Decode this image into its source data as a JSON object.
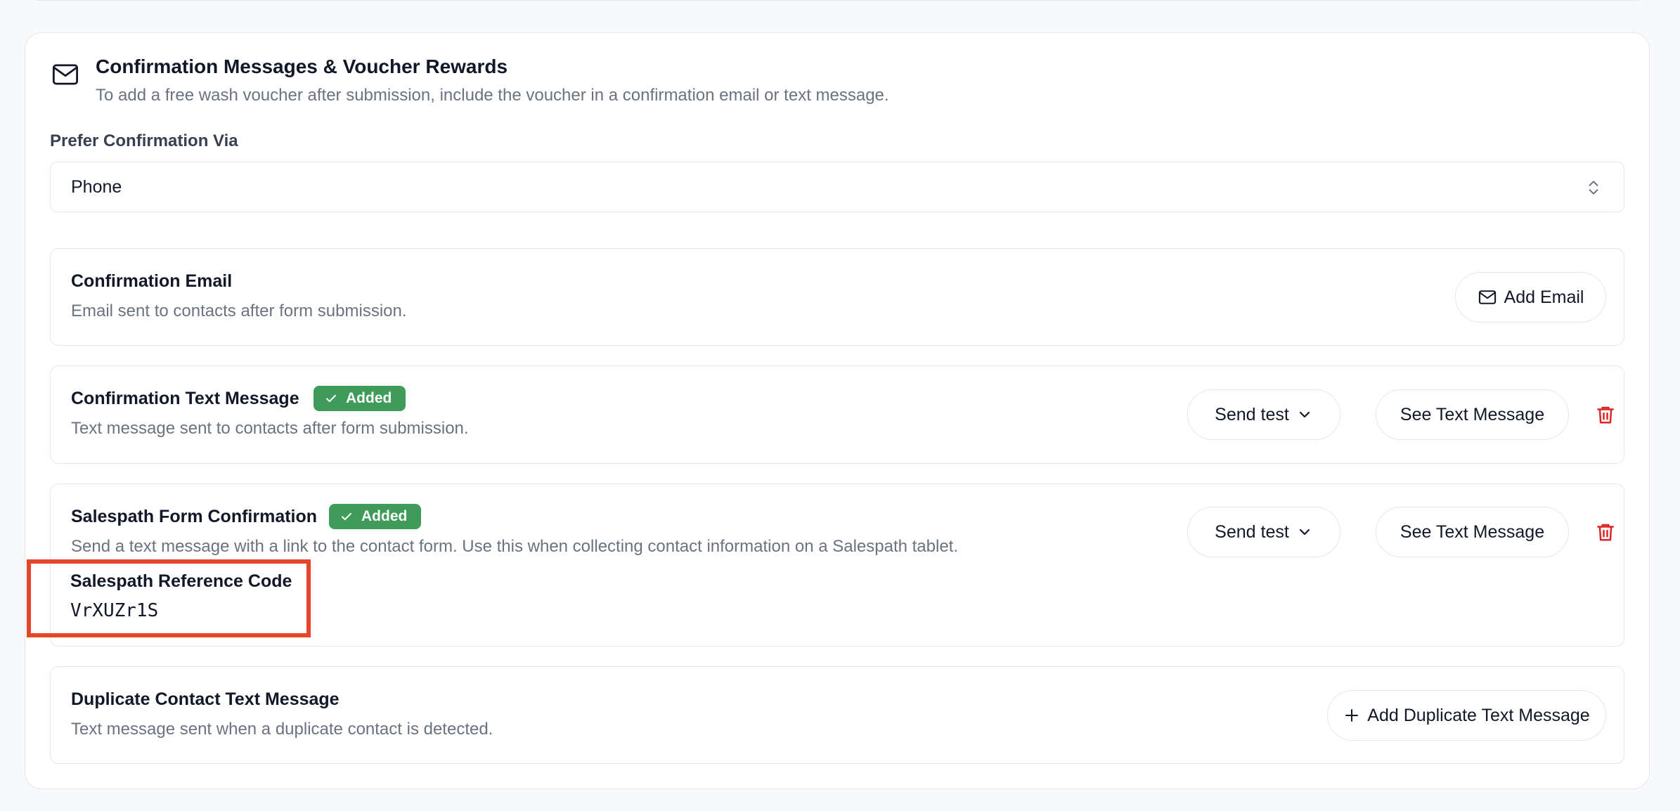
{
  "header": {
    "icon": "mail-icon",
    "title": "Confirmation Messages & Voucher Rewards",
    "subtitle": "To add a free wash voucher after submission, include the voucher in a confirmation email or text message."
  },
  "preference": {
    "label": "Prefer Confirmation Via",
    "selected": "Phone",
    "icon": "chevron-updown-icon"
  },
  "email": {
    "title": "Confirmation Email",
    "description": "Email sent to contacts after form submission.",
    "add_label": "Add Email"
  },
  "text_message": {
    "title": "Confirmation Text Message",
    "badge": "Added",
    "description": "Text message sent to contacts after form submission.",
    "send_test_label": "Send test",
    "see_label": "See Text Message"
  },
  "salespath": {
    "title": "Salespath Form Confirmation",
    "badge": "Added",
    "description": "Send a text message with a link to the contact form. Use this when collecting contact information on a Salespath tablet.",
    "send_test_label": "Send test",
    "see_label": "See Text Message",
    "ref_label": "Salespath Reference Code",
    "ref_code": "VrXUZr1S"
  },
  "duplicate": {
    "title": "Duplicate Contact Text Message",
    "description": "Text message sent when a duplicate contact is detected.",
    "add_label": "Add Duplicate Text Message"
  },
  "colors": {
    "badge_green": "#3f9b5a",
    "trash_red": "#dc2626",
    "highlight_red": "#e5452b",
    "muted_text": "#6b7280"
  }
}
